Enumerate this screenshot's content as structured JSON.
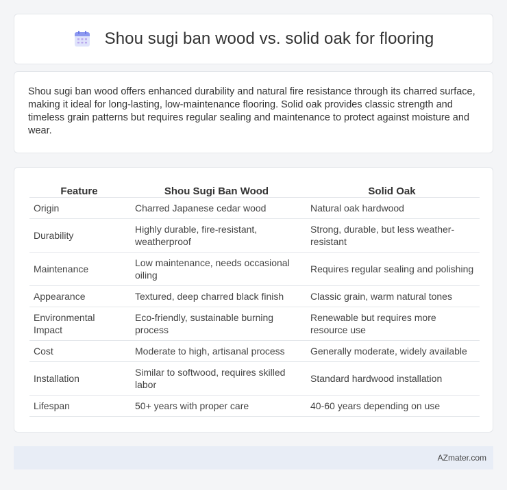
{
  "header": {
    "title": "Shou sugi ban wood vs. solid oak for flooring",
    "icon": "calendar-icon"
  },
  "summary": {
    "text": "Shou sugi ban wood offers enhanced durability and natural fire resistance through its charred surface, making it ideal for long-lasting, low-maintenance flooring. Solid oak provides classic strength and timeless grain patterns but requires regular sealing and maintenance to protect against moisture and wear."
  },
  "table": {
    "headers": [
      "Feature",
      "Shou Sugi Ban Wood",
      "Solid Oak"
    ],
    "rows": [
      [
        "Origin",
        "Charred Japanese cedar wood",
        "Natural oak hardwood"
      ],
      [
        "Durability",
        "Highly durable, fire-resistant, weatherproof",
        "Strong, durable, but less weather-resistant"
      ],
      [
        "Maintenance",
        "Low maintenance, needs occasional oiling",
        "Requires regular sealing and polishing"
      ],
      [
        "Appearance",
        "Textured, deep charred black finish",
        "Classic grain, warm natural tones"
      ],
      [
        "Environmental Impact",
        "Eco-friendly, sustainable burning process",
        "Renewable but requires more resource use"
      ],
      [
        "Cost",
        "Moderate to high, artisanal process",
        "Generally moderate, widely available"
      ],
      [
        "Installation",
        "Similar to softwood, requires skilled labor",
        "Standard hardwood installation"
      ],
      [
        "Lifespan",
        "50+ years with proper care",
        "40-60 years depending on use"
      ]
    ]
  },
  "footer": {
    "text": "AZmater.com"
  },
  "colors": {
    "background": "#f4f5f7",
    "card": "#ffffff",
    "footer_bg": "#e8edf6",
    "icon_accent": "#7b8cf5"
  }
}
